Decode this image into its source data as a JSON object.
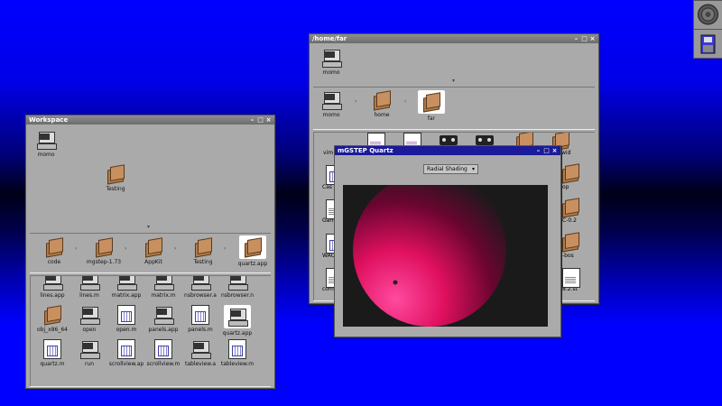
{
  "colors": {
    "accent": "#1a1a9a",
    "desktop": "#0000ff",
    "sphere": "#ff2a8a"
  },
  "workspace": {
    "title": "Workspace",
    "top_icons": [
      {
        "label": "momo",
        "icon": "computer-icon"
      },
      {
        "label": "Testing",
        "icon": "folder-icon"
      }
    ],
    "path": [
      {
        "label": "code",
        "icon": "folder-icon"
      },
      {
        "label": "mgstep-1.73",
        "icon": "folder-icon"
      },
      {
        "label": "AppKit",
        "icon": "folder-icon"
      },
      {
        "label": "Testing",
        "icon": "folder-icon"
      },
      {
        "label": "quartz.app",
        "icon": "folder-icon",
        "selected": true
      }
    ],
    "files": [
      {
        "label": "lines.app",
        "icon": "computer-icon"
      },
      {
        "label": "lines.m",
        "icon": "computer-icon"
      },
      {
        "label": "matrix.app",
        "icon": "computer-icon"
      },
      {
        "label": "matrix.m",
        "icon": "computer-icon"
      },
      {
        "label": "nsbrowser.a",
        "icon": "computer-icon"
      },
      {
        "label": "nsbrowser.n",
        "icon": "computer-icon"
      },
      {
        "label": "obj_x86_64",
        "icon": "folder-icon"
      },
      {
        "label": "open",
        "icon": "computer-icon"
      },
      {
        "label": "open.m",
        "icon": "document-icon"
      },
      {
        "label": "panels.app",
        "icon": "computer-icon"
      },
      {
        "label": "panels.m",
        "icon": "document-icon"
      },
      {
        "label": "quartz.app",
        "icon": "computer-icon",
        "selected": true
      },
      {
        "label": "quartz.m",
        "icon": "document-icon"
      },
      {
        "label": "run",
        "icon": "computer-icon"
      },
      {
        "label": "scrollview.ap",
        "icon": "document-icon"
      },
      {
        "label": "scrollview.m",
        "icon": "document-icon"
      },
      {
        "label": "tableview.a",
        "icon": "computer-icon"
      },
      {
        "label": "tableview.m",
        "icon": "document-icon"
      }
    ]
  },
  "home": {
    "title": "/home/far",
    "top_icons": [
      {
        "label": "momo",
        "icon": "computer-icon"
      }
    ],
    "path": [
      {
        "label": "momo",
        "icon": "computer-icon"
      },
      {
        "label": "home",
        "icon": "folder-icon"
      },
      {
        "label": "far",
        "icon": "folder-icon",
        "selected": true
      }
    ],
    "partial_labels": [
      "vim",
      "Cas",
      "Gam",
      "WAC",
      "comp",
      "wid",
      "op",
      "C-0.2",
      "-bos",
      "8.2.st"
    ]
  },
  "quartz": {
    "title": "mGSTEP Quartz",
    "shading_select": "Radial Shading"
  }
}
